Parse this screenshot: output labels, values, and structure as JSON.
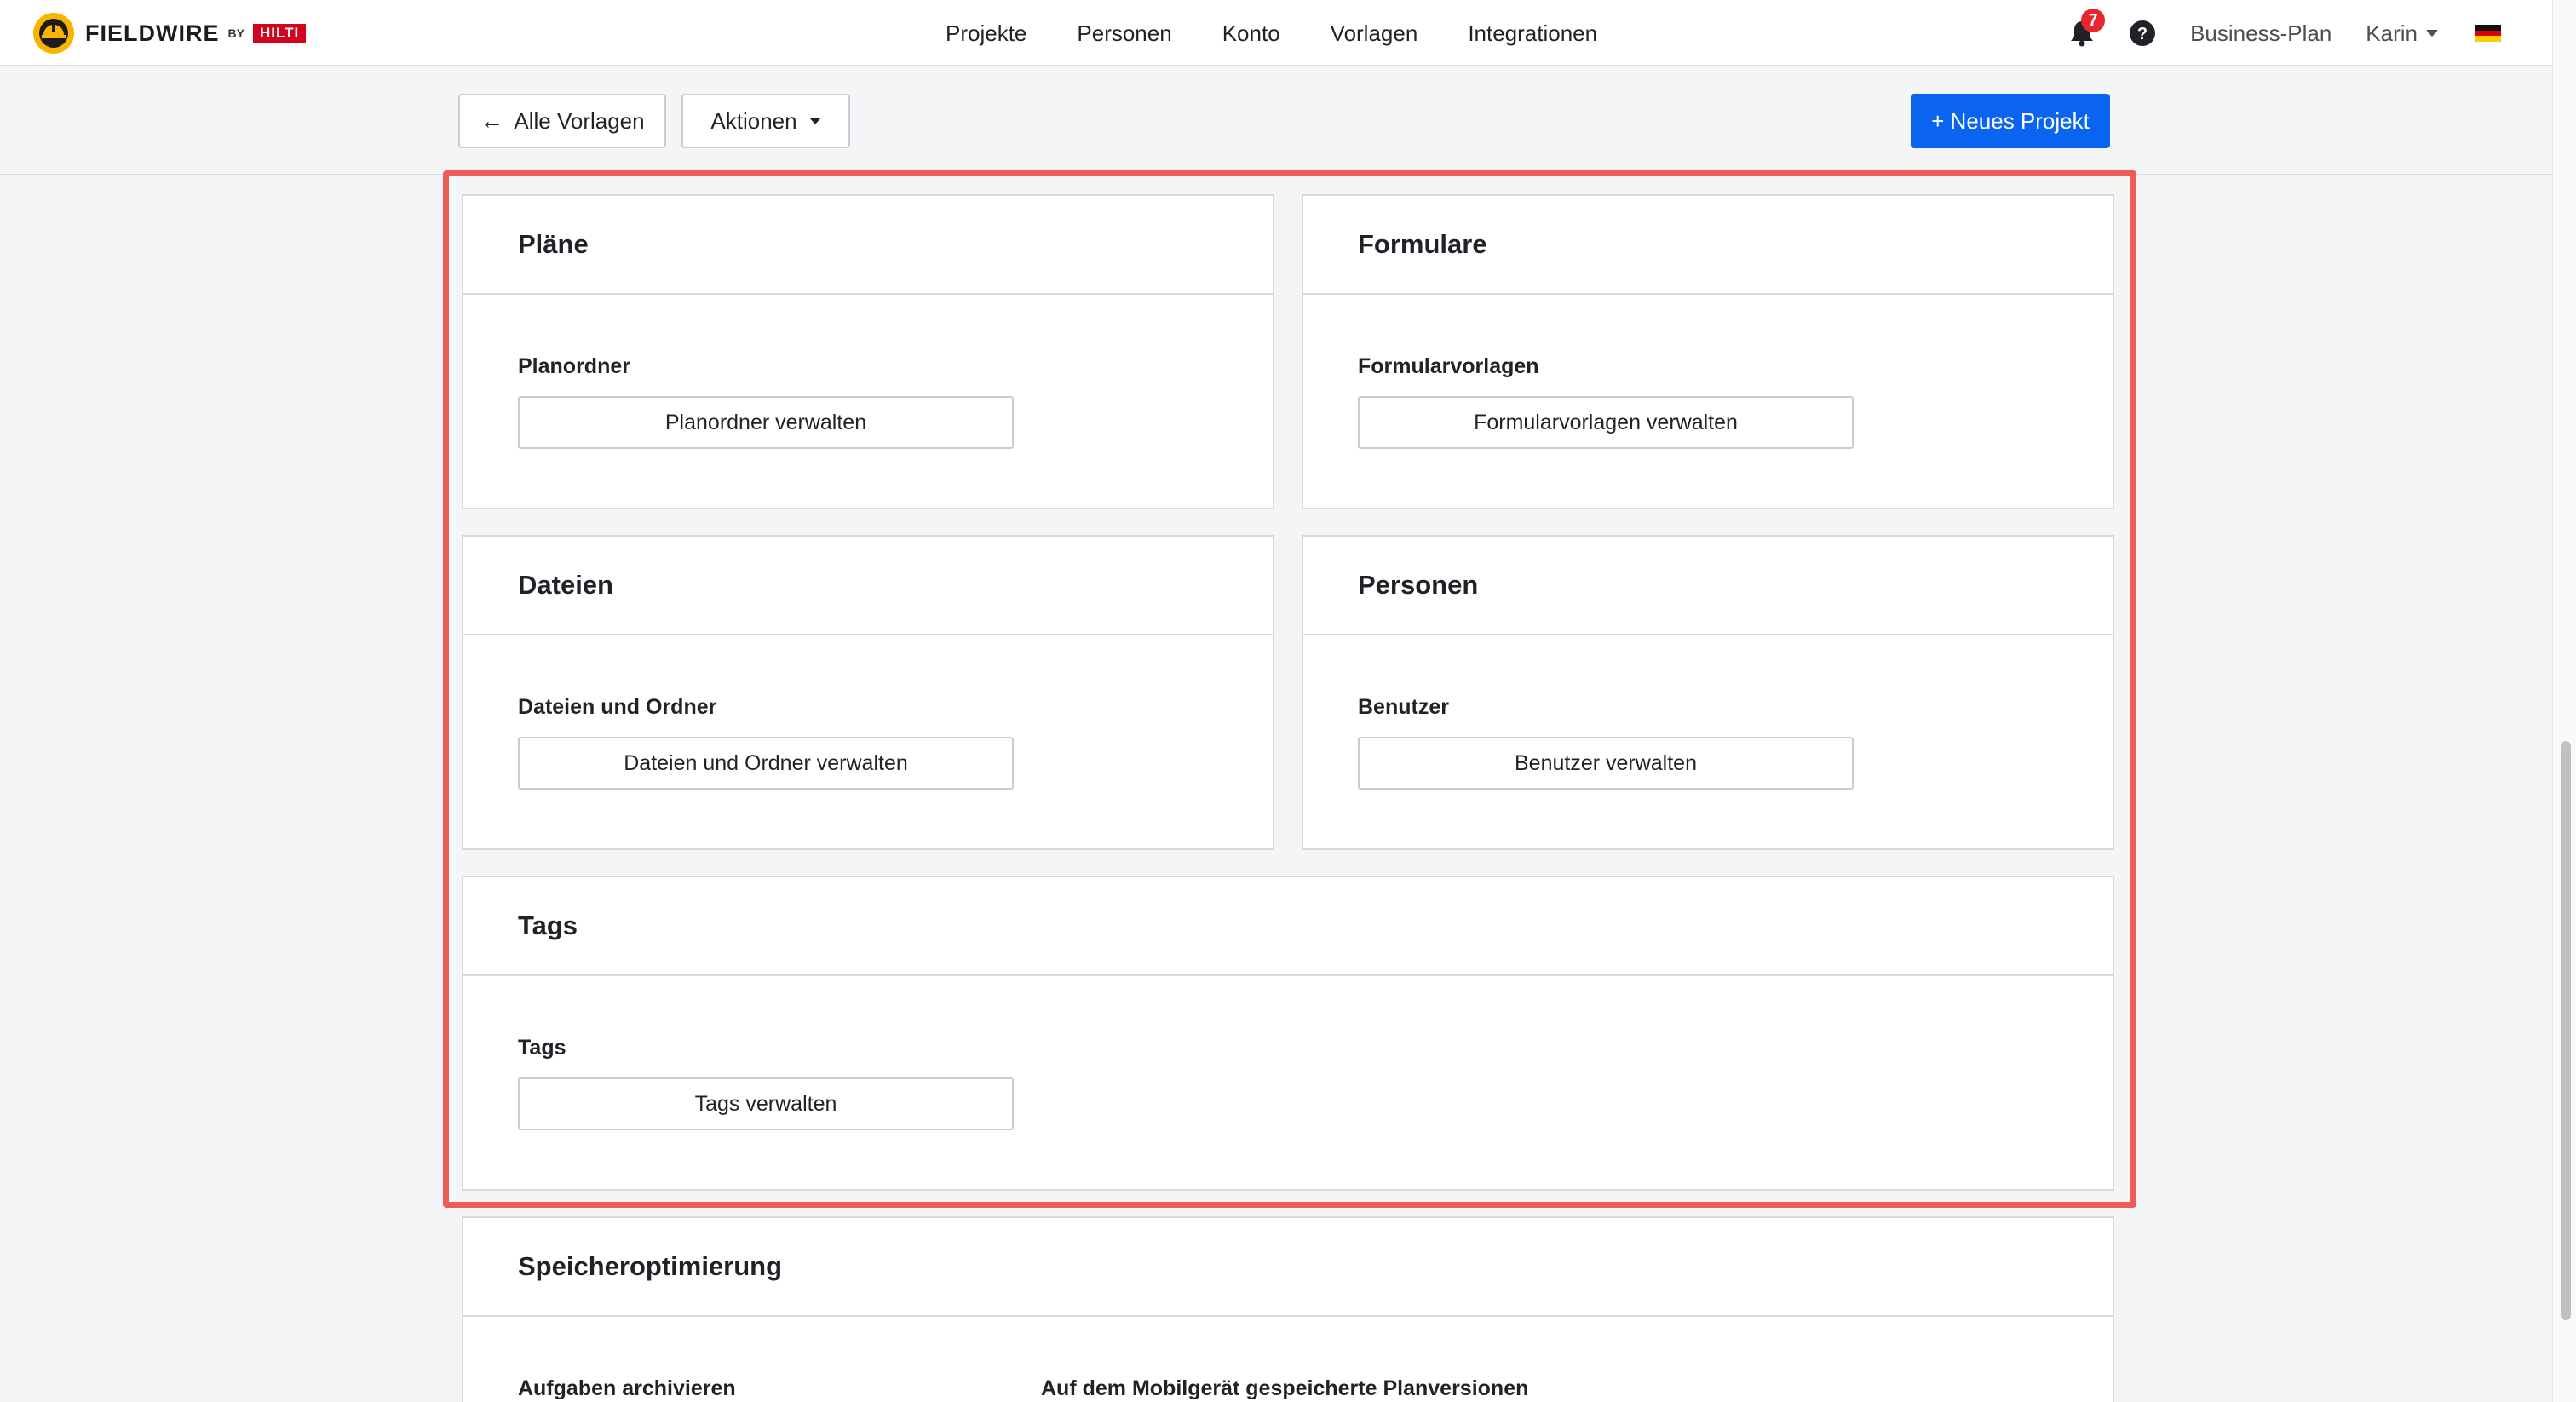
{
  "brand": {
    "name": "FIELDWIRE",
    "by": "BY",
    "partner": "HILTI"
  },
  "nav": {
    "items": [
      "Projekte",
      "Personen",
      "Konto",
      "Vorlagen",
      "Integrationen"
    ]
  },
  "header_right": {
    "notifications_count": "7",
    "plan": "Business-Plan",
    "user": "Karin"
  },
  "toolbar": {
    "back_label": "Alle Vorlagen",
    "actions_label": "Aktionen",
    "new_project_label": "+ Neues Projekt"
  },
  "cards": {
    "plaene": {
      "title": "Pläne",
      "sub": "Planordner",
      "button": "Planordner verwalten"
    },
    "formulare": {
      "title": "Formulare",
      "sub": "Formularvorlagen",
      "button": "Formularvorlagen verwalten"
    },
    "dateien": {
      "title": "Dateien",
      "sub": "Dateien und Ordner",
      "button": "Dateien und Ordner verwalten"
    },
    "personen": {
      "title": "Personen",
      "sub": "Benutzer",
      "button": "Benutzer verwalten"
    },
    "tags": {
      "title": "Tags",
      "sub": "Tags",
      "button": "Tags verwalten"
    },
    "speicher": {
      "title": "Speicheroptimierung",
      "sub1": "Aufgaben archivieren",
      "sub2": "Auf dem Mobilgerät gespeicherte Planversionen"
    }
  },
  "colors": {
    "primary": "#0a64f0",
    "highlight": "#ec5d57",
    "badge": "#e6252c",
    "logo": "#f7b500"
  }
}
